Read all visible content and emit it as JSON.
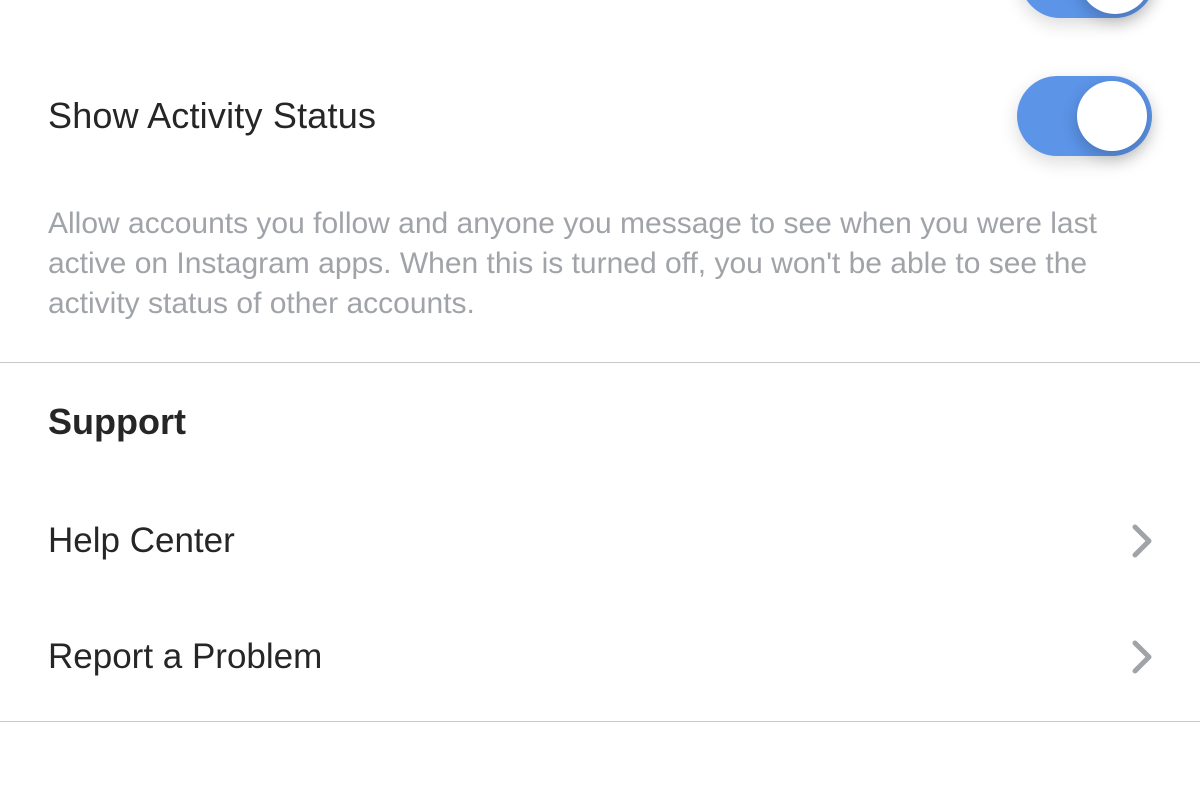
{
  "activity": {
    "title": "Show Activity Status",
    "toggle_on": true,
    "description": "Allow accounts you follow and anyone you message to see when you were last active on Instagram apps. When this is turned off, you won't be able to see the activity status of other accounts."
  },
  "support": {
    "header": "Support",
    "items": [
      {
        "label": "Help Center"
      },
      {
        "label": "Report a Problem"
      }
    ]
  }
}
